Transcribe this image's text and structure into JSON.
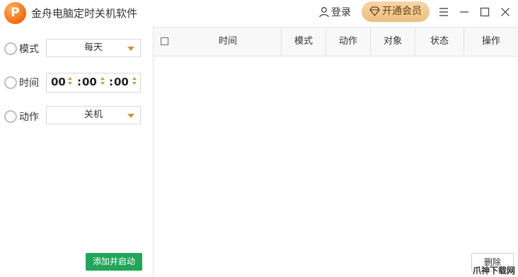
{
  "app": {
    "logo_letter": "P",
    "title": "金舟电脑定时关机软件",
    "login_label": "登录",
    "vip_label": "开通会员"
  },
  "form": {
    "mode_label": "模式",
    "mode_value": "每天",
    "time_label": "时间",
    "hours": "00",
    "minutes": "00",
    "seconds": "00",
    "time_sep": ":",
    "action_label": "动作",
    "action_value": "关机",
    "add_button": "添加并启动"
  },
  "table": {
    "columns": [
      "时间",
      "模式",
      "动作",
      "对象",
      "状态",
      "操作"
    ],
    "rows": []
  },
  "delete_button": "删除",
  "watermark": "爪神下载网",
  "colors": {
    "accent_orange": "#f26a12",
    "vip_gold": "#ebbf82",
    "add_green": "#21a55a"
  },
  "icons": [
    "user-icon",
    "diamond-icon",
    "menu-icon",
    "minimize-icon",
    "maximize-icon",
    "close-icon",
    "clock-icon",
    "timer-icon",
    "action-icon"
  ]
}
